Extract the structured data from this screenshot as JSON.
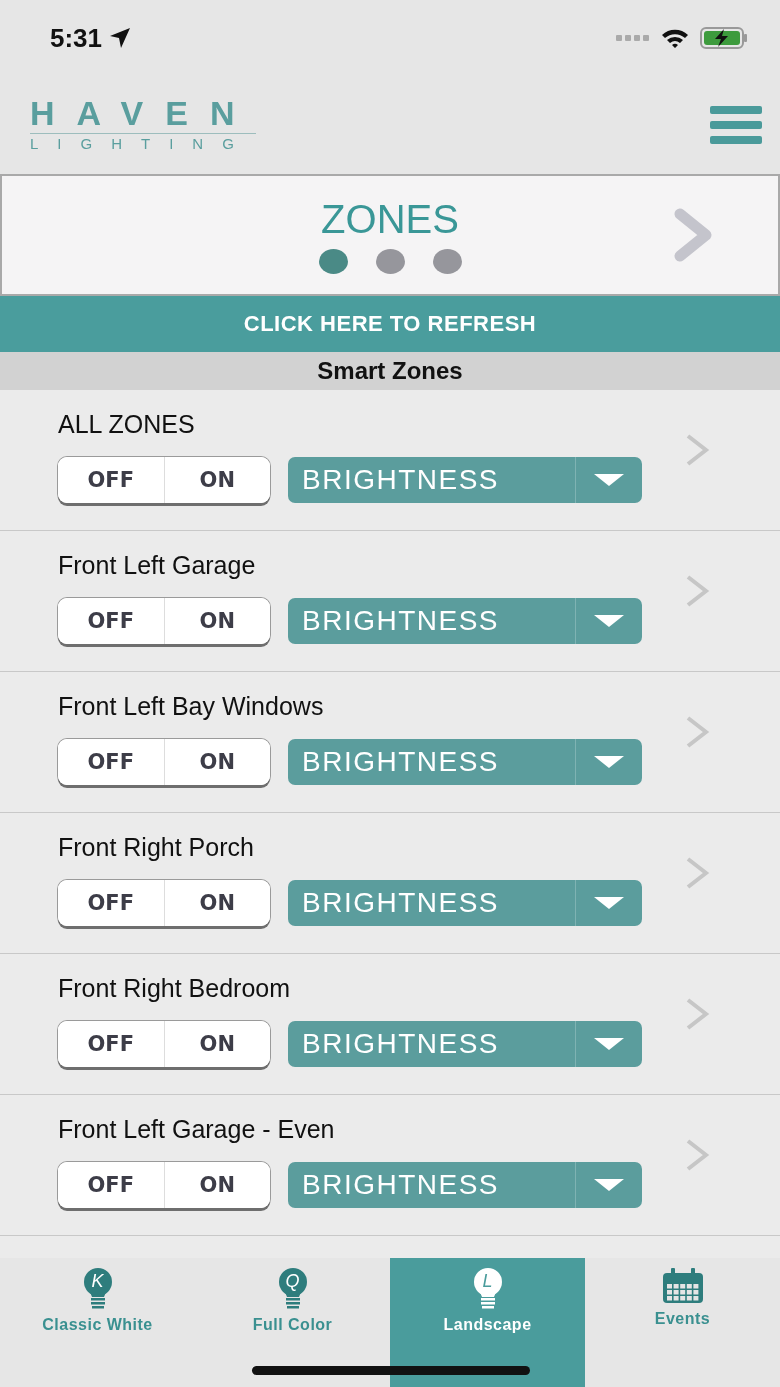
{
  "status_bar": {
    "time": "5:31"
  },
  "header": {
    "logo_top": "HAVEN",
    "logo_bottom": "LIGHTING"
  },
  "banner": {
    "title": "ZONES",
    "pages": [
      {
        "selected": true
      },
      {
        "selected": false
      },
      {
        "selected": false
      }
    ]
  },
  "refresh_button": "CLICK HERE TO REFRESH",
  "section_title": "Smart Zones",
  "zones": [
    {
      "name": "ALL ZONES",
      "switch": [
        {
          "label": "OFF",
          "selected": false
        },
        {
          "label": "ON",
          "selected": false
        }
      ],
      "dropdown": "BRIGHTNESS"
    },
    {
      "name": "Front Left Garage",
      "switch": [
        {
          "label": "OFF",
          "selected": false
        },
        {
          "label": "ON",
          "selected": false
        }
      ],
      "dropdown": "BRIGHTNESS"
    },
    {
      "name": "Front Left Bay Windows",
      "switch": [
        {
          "label": "OFF",
          "selected": false
        },
        {
          "label": "ON",
          "selected": false
        }
      ],
      "dropdown": "BRIGHTNESS"
    },
    {
      "name": "Front Right Porch",
      "switch": [
        {
          "label": "OFF",
          "selected": false
        },
        {
          "label": "ON",
          "selected": false
        }
      ],
      "dropdown": "BRIGHTNESS"
    },
    {
      "name": "Front Right Bedroom",
      "switch": [
        {
          "label": "OFF",
          "selected": false
        },
        {
          "label": "ON",
          "selected": false
        }
      ],
      "dropdown": "BRIGHTNESS"
    },
    {
      "name": "Front Left Garage - Even",
      "switch": [
        {
          "label": "OFF",
          "selected": false
        },
        {
          "label": "ON",
          "selected": false
        }
      ],
      "dropdown": "BRIGHTNESS"
    }
  ],
  "tabs": [
    {
      "label": "Classic White",
      "kind": "bulb",
      "glyph": "K",
      "selected": false
    },
    {
      "label": "Full Color",
      "kind": "bulb",
      "glyph": "Q",
      "selected": false
    },
    {
      "label": "Landscape",
      "kind": "bulb",
      "glyph": "L",
      "selected": true
    },
    {
      "label": "Events",
      "kind": "calendar",
      "selected": false
    }
  ]
}
